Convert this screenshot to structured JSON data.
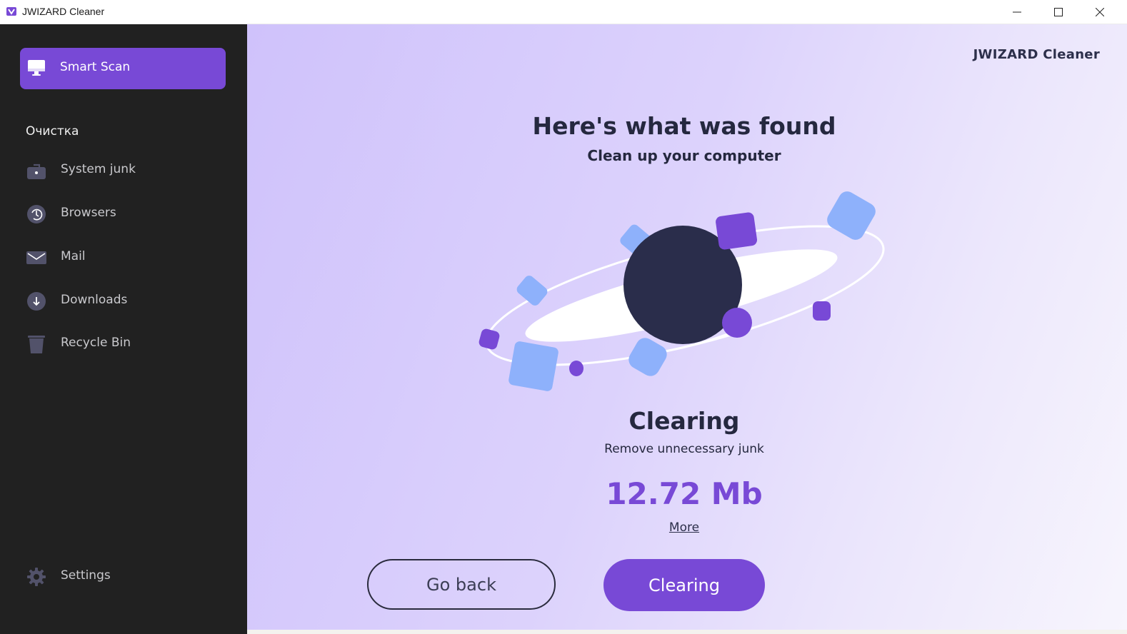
{
  "window": {
    "title": "JWIZARD Cleaner"
  },
  "sidebar": {
    "smart_scan": {
      "label": "Smart Scan",
      "icon": "monitor-icon"
    },
    "section_title": "Очистка",
    "items": [
      {
        "label": "System junk",
        "icon": "briefcase-icon"
      },
      {
        "label": "Browsers",
        "icon": "history-icon"
      },
      {
        "label": "Mail",
        "icon": "mail-icon"
      },
      {
        "label": "Downloads",
        "icon": "download-icon"
      },
      {
        "label": "Recycle Bin",
        "icon": "trash-icon"
      }
    ],
    "settings": {
      "label": "Settings",
      "icon": "gear-icon"
    }
  },
  "main": {
    "brand": "JWIZARD Cleaner",
    "headline": "Here's what was found",
    "subhead": "Clean up your computer",
    "status_title": "Clearing",
    "status_sub": "Remove unnecessary junk",
    "size_value": "12.72 Mb",
    "more_link": "More",
    "go_back_button": "Go back",
    "clearing_button": "Clearing"
  },
  "colors": {
    "accent": "#7849d6",
    "sidebar_bg": "#212121",
    "planet": "#2a2d4b",
    "light_blue": "#8eb1fb",
    "text_dark": "#25283f"
  }
}
